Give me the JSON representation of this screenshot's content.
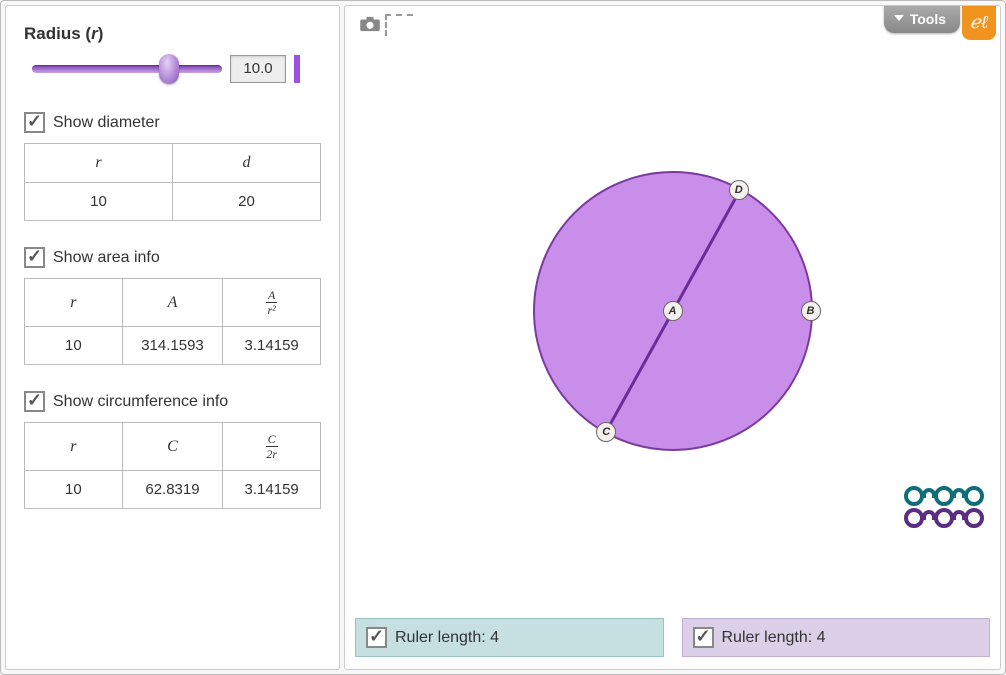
{
  "sidebar": {
    "radius_label_prefix": "Radius (",
    "radius_label_var": "r",
    "radius_label_suffix": ")",
    "radius_value": "10.0",
    "show_diameter_label": "Show diameter",
    "show_area_label": "Show area info",
    "show_circumference_label": "Show circumference info",
    "diameter_table": {
      "headers": {
        "r": "r",
        "d": "d"
      },
      "values": {
        "r": "10",
        "d": "20"
      }
    },
    "area_table": {
      "headers": {
        "r": "r",
        "A": "A",
        "ratio_num": "A",
        "ratio_den": "r²"
      },
      "values": {
        "r": "10",
        "A": "314.1593",
        "ratio": "3.14159"
      }
    },
    "circ_table": {
      "headers": {
        "r": "r",
        "C": "C",
        "ratio_num": "C",
        "ratio_den": "2r"
      },
      "values": {
        "r": "10",
        "C": "62.8319",
        "ratio": "3.14159"
      }
    }
  },
  "canvas": {
    "points": {
      "A": "A",
      "B": "B",
      "C": "C",
      "D": "D"
    }
  },
  "tools_label": "Tools",
  "logo_text": "ℯℓ",
  "ruler_bar_teal": "Ruler length: 4",
  "ruler_bar_purple": "Ruler length: 4"
}
